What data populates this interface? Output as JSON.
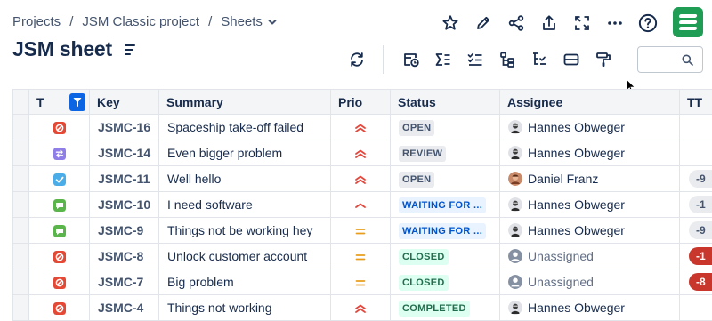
{
  "breadcrumb": {
    "items": [
      "Projects",
      "JSM Classic project",
      "Sheets"
    ],
    "separator": "/"
  },
  "page": {
    "title": "JSM sheet"
  },
  "top_actions": [
    "star-icon",
    "edit-icon",
    "share-icon",
    "export-icon",
    "fullscreen-icon",
    "more-icon",
    "help-icon"
  ],
  "toolbar": [
    "refresh-icon",
    "new-view-icon",
    "sum-icon",
    "checklist-icon",
    "hierarchy-icon",
    "tree-filter-icon",
    "row-height-icon",
    "format-paint-icon"
  ],
  "search": {
    "value": "",
    "placeholder": ""
  },
  "grid": {
    "columns": [
      "T",
      "Key",
      "Summary",
      "Prio",
      "Status",
      "Assignee",
      "TT"
    ],
    "rows": [
      {
        "type": "incident",
        "type_color": "#e34935",
        "key": "JSMC-16",
        "summary": "Spaceship take-off failed",
        "prio": "highest",
        "status": "OPEN",
        "status_style": "default",
        "assignee": "Hannes Obweger",
        "assigned": true,
        "ttr": ""
      },
      {
        "type": "change",
        "type_color": "#8f7ee7",
        "key": "JSMC-14",
        "summary": "Even bigger problem",
        "prio": "highest",
        "status": "REVIEW",
        "status_style": "default",
        "assignee": "Hannes Obweger",
        "assigned": true,
        "ttr": ""
      },
      {
        "type": "task",
        "type_color": "#4bade8",
        "key": "JSMC-11",
        "summary": "Well hello",
        "prio": "highest",
        "status": "OPEN",
        "status_style": "default",
        "assignee": "Daniel Franz",
        "assigned": true,
        "ttr": "-9"
      },
      {
        "type": "service-request",
        "type_color": "#5ab54b",
        "key": "JSMC-10",
        "summary": "I need software",
        "prio": "high",
        "status": "WAITING FOR ...",
        "status_style": "blue",
        "assignee": "Hannes Obweger",
        "assigned": true,
        "ttr": "-1"
      },
      {
        "type": "service-request",
        "type_color": "#5ab54b",
        "key": "JSMC-9",
        "summary": "Things not be working hey",
        "prio": "medium",
        "status": "WAITING FOR ...",
        "status_style": "blue",
        "assignee": "Hannes Obweger",
        "assigned": true,
        "ttr": "-9"
      },
      {
        "type": "incident",
        "type_color": "#e34935",
        "key": "JSMC-8",
        "summary": "Unlock customer account",
        "prio": "medium",
        "status": "CLOSED",
        "status_style": "green",
        "assignee": "Unassigned",
        "assigned": false,
        "ttr": "-1"
      },
      {
        "type": "incident",
        "type_color": "#e34935",
        "key": "JSMC-7",
        "summary": "Big problem",
        "prio": "medium",
        "status": "CLOSED",
        "status_style": "green",
        "assignee": "Unassigned",
        "assigned": false,
        "ttr": "-8"
      },
      {
        "type": "incident",
        "type_color": "#e34935",
        "key": "JSMC-4",
        "summary": "Things not working",
        "prio": "highest",
        "status": "COMPLETED",
        "status_style": "green",
        "assignee": "Hannes Obweger",
        "assigned": true,
        "ttr": ""
      }
    ],
    "ttr_styles": [
      "",
      "",
      "grey",
      "grey",
      "grey",
      "red",
      "red",
      ""
    ]
  },
  "colors": {
    "accent": "#0c66e4",
    "logo": "#1f9d55",
    "prio_high": "#e2483d",
    "prio_medium": "#e99e1b"
  }
}
